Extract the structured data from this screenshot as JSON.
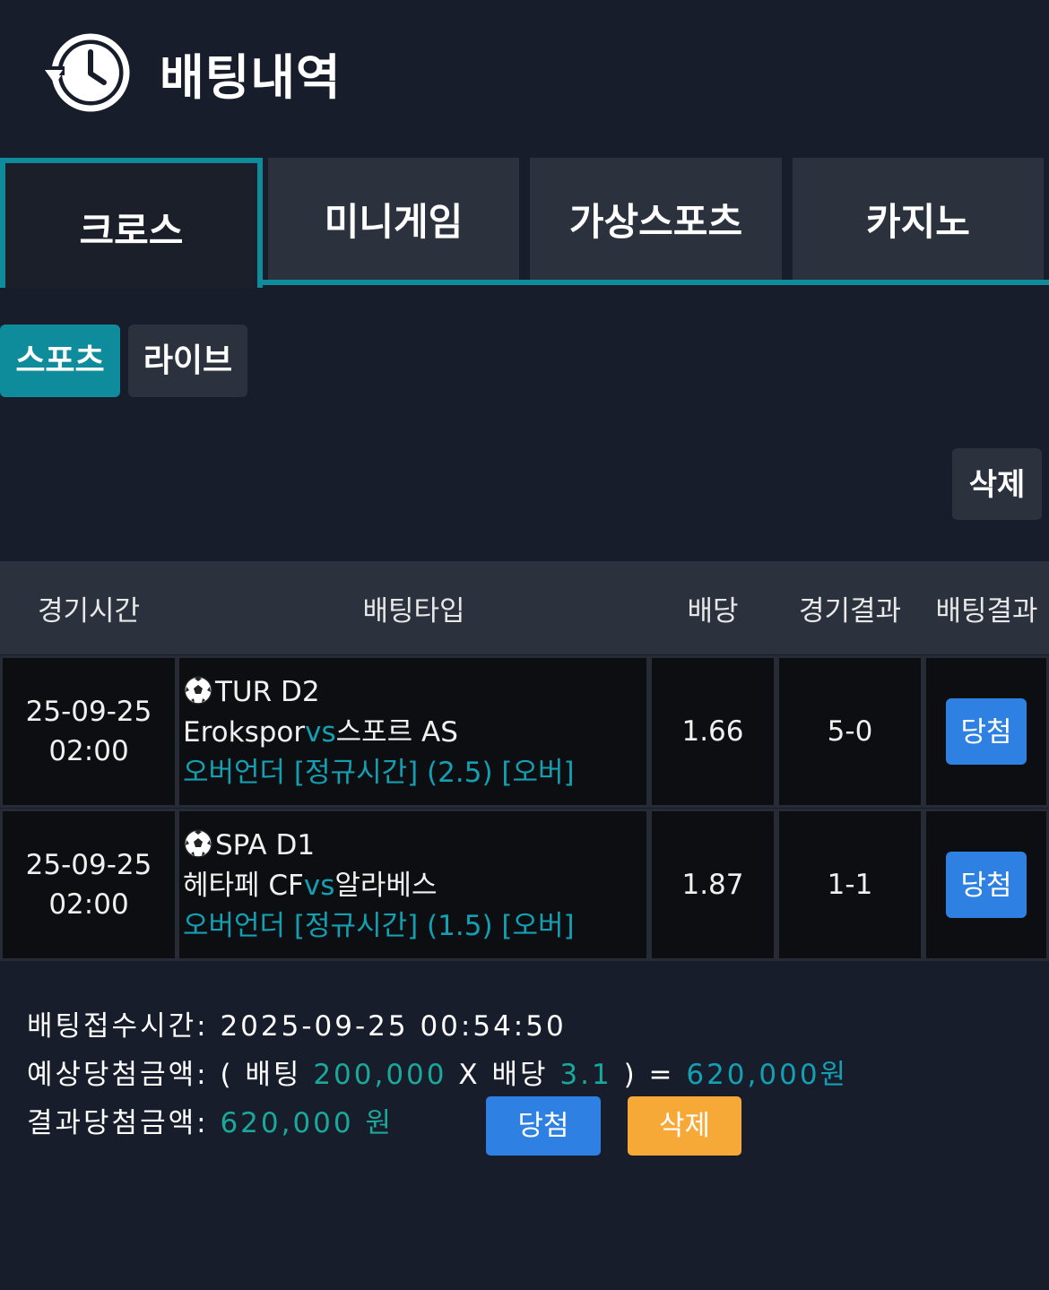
{
  "page": {
    "title": "배팅내역",
    "icon": "history-clock-icon"
  },
  "main_tabs": [
    {
      "label": "크로스",
      "active": true
    },
    {
      "label": "미니게임",
      "active": false
    },
    {
      "label": "가상스포츠",
      "active": false
    },
    {
      "label": "카지노",
      "active": false
    }
  ],
  "sub_tabs": [
    {
      "label": "스포츠",
      "active": true
    },
    {
      "label": "라이브",
      "active": false
    }
  ],
  "delete_top_label": "삭제",
  "table": {
    "headers": [
      "경기시간",
      "배팅타입",
      "배당",
      "경기결과",
      "배팅결과"
    ],
    "rows": [
      {
        "date": "25-09-25",
        "time": "02:00",
        "league": "TUR D2",
        "home": "Erokspor",
        "vs": "vs",
        "away": "스포르 AS",
        "bet": "오버언더 [정규시간] (2.5) [오버]",
        "odds": "1.66",
        "score": "5-0",
        "result": "당첨"
      },
      {
        "date": "25-09-25",
        "time": "02:00",
        "league": "SPA D1",
        "home": "헤타페 CF",
        "vs": "vs",
        "away": "알라베스",
        "bet": "오버언더 [정규시간] (1.5) [오버]",
        "odds": "1.87",
        "score": "1-1",
        "result": "당첨"
      }
    ]
  },
  "summary": {
    "received_label": "배팅접수시간:",
    "received_value": "2025-09-25 00:54:50",
    "expected_label": "예상당첨금액:",
    "open_paren": "(",
    "bet_label": "배팅",
    "bet_amount": "200,000",
    "times": "X",
    "odds_label": "배당",
    "total_odds": "3.1",
    "close_paren_eq": ") =",
    "expected_amount": "620,000원",
    "result_label": "결과당첨금액:",
    "result_amount": "620,000 원",
    "win_button": "당첨",
    "delete_button": "삭제"
  },
  "colors": {
    "background": "#181d2c",
    "accent_teal": "#0f8c9b",
    "win_blue": "#2e80e2",
    "delete_orange": "#f7a937",
    "green_text": "#1aa89a"
  }
}
